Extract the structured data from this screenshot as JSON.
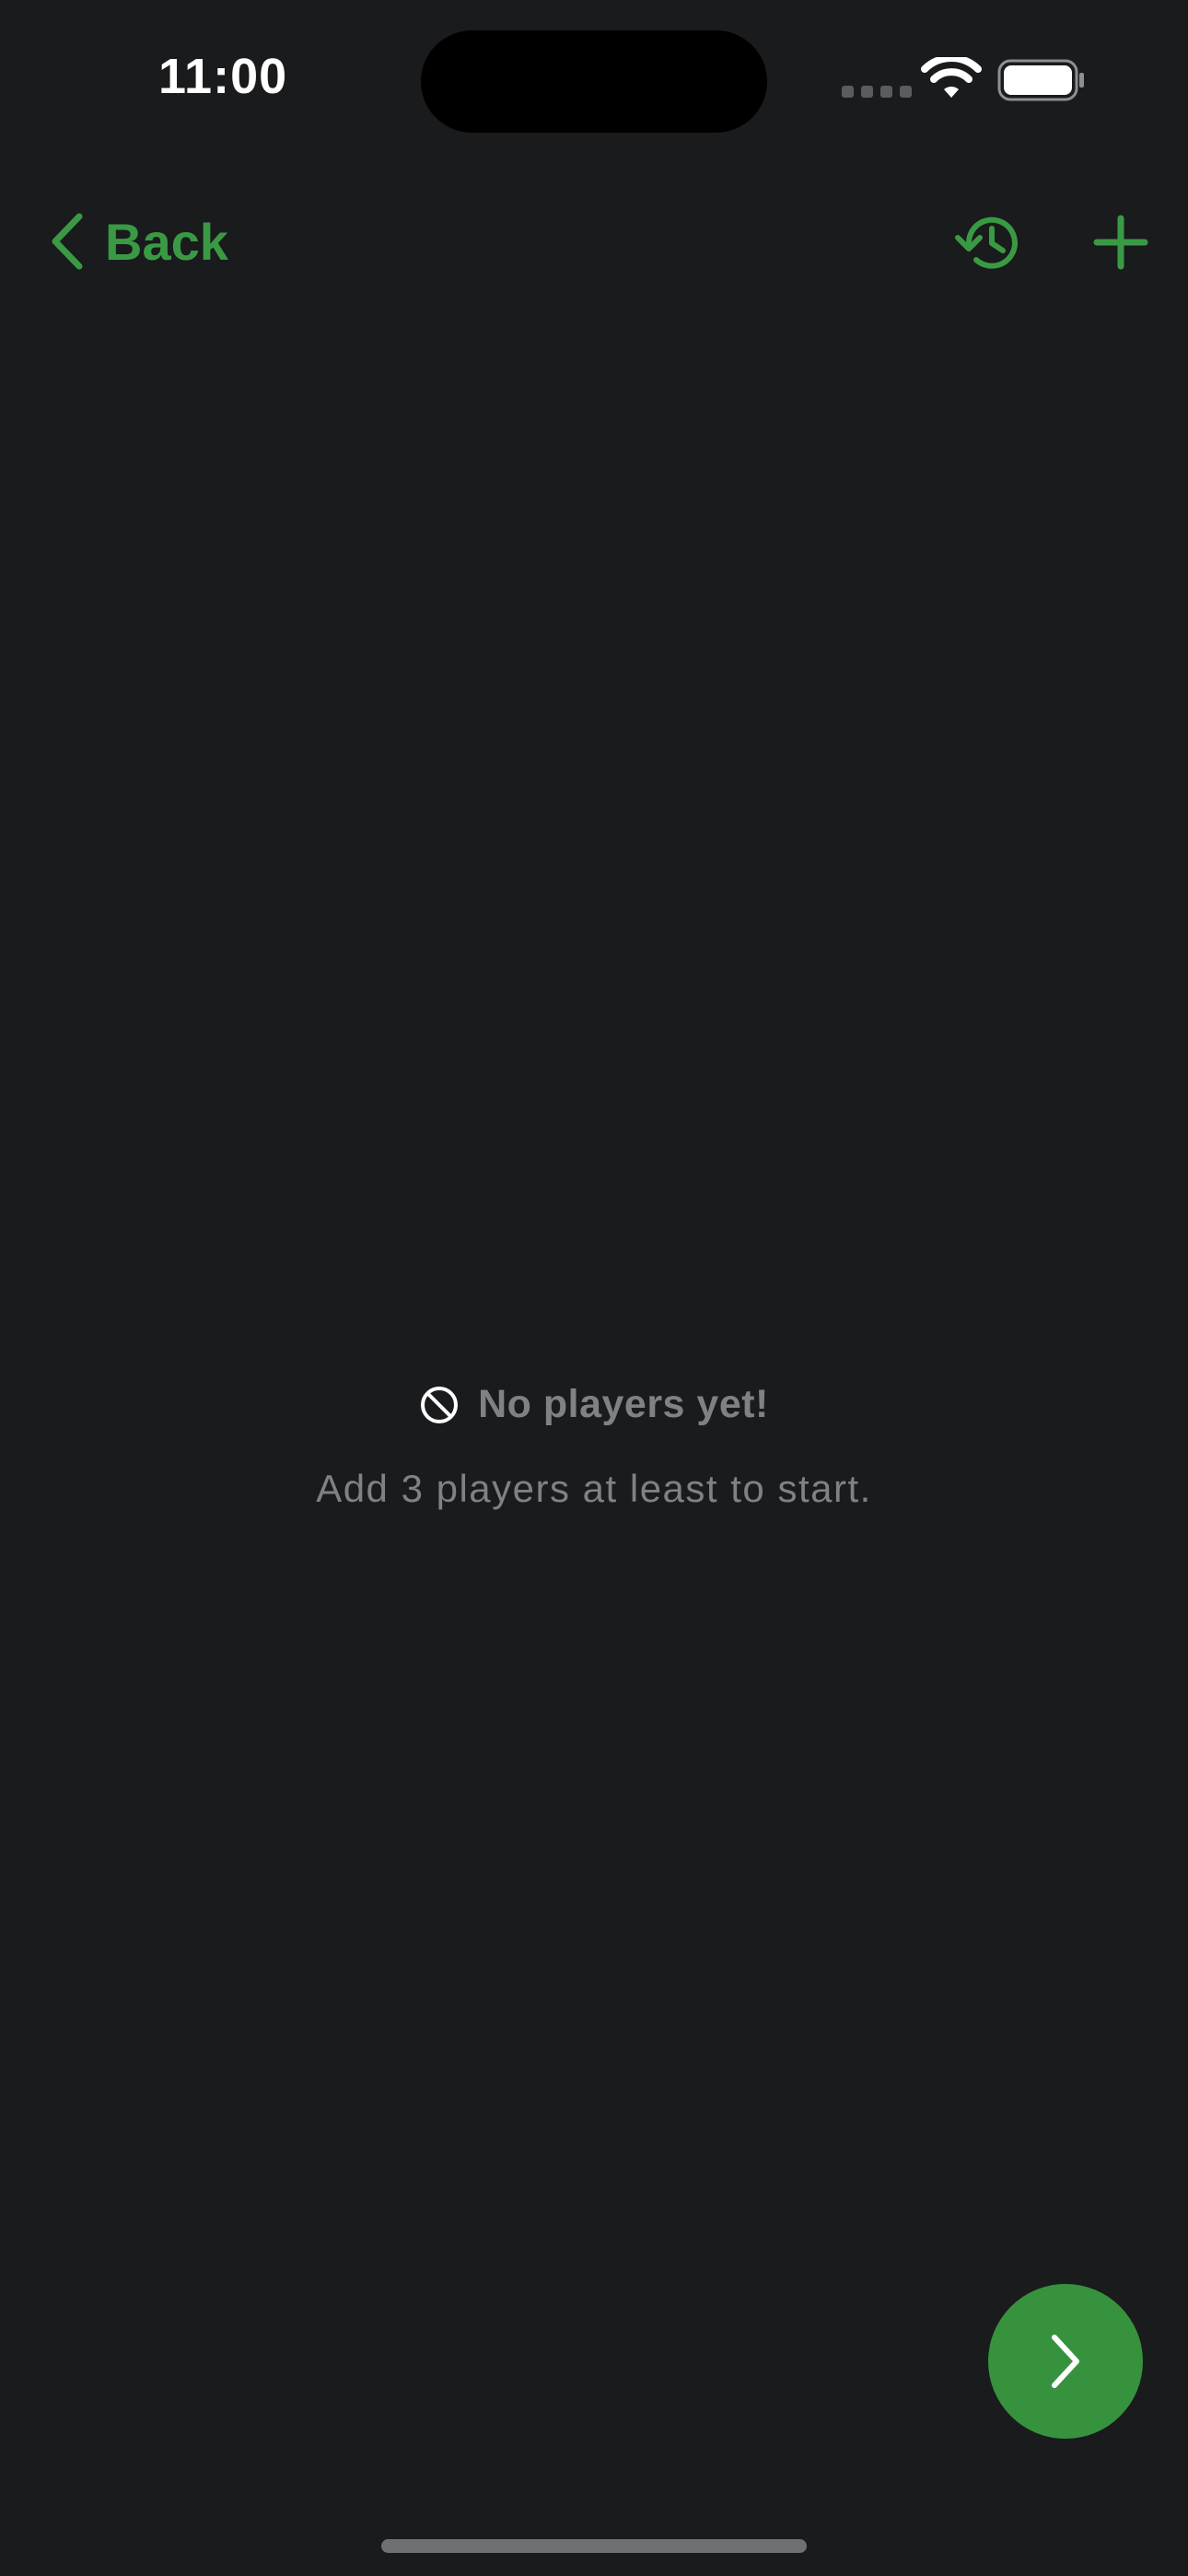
{
  "status_bar": {
    "time": "11:00"
  },
  "nav": {
    "back_label": "Back",
    "back_icon": "chevron-left-icon",
    "history_icon": "history-icon",
    "add_icon": "plus-icon"
  },
  "empty_state": {
    "icon": "block-icon",
    "title": "No players yet!",
    "subtitle": "Add 3 players at least to start."
  },
  "fab": {
    "icon": "chevron-right-icon"
  },
  "colors": {
    "background": "#1a1b1d",
    "accent": "#3a9a44",
    "fab": "#37923e",
    "muted_text": "#808184"
  }
}
